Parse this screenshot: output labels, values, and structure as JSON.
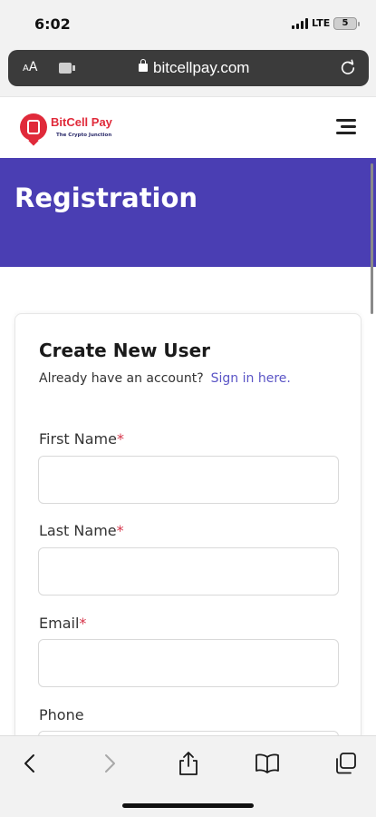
{
  "status_bar": {
    "time": "6:02",
    "network": "LTE",
    "battery": "5"
  },
  "browser": {
    "aa_label_small": "A",
    "aa_label_large": "A",
    "url": "bitcellpay.com"
  },
  "site": {
    "logo_name": "BitCell Pay",
    "logo_tagline": "The Crypto Junction"
  },
  "hero": {
    "title": "Registration",
    "background_color": "#4a3eb3"
  },
  "form": {
    "title": "Create New User",
    "subtitle": "Already have an account?",
    "signin_link": "Sign in here.",
    "required_marker": "*",
    "fields": [
      {
        "label": "First Name",
        "required": true,
        "value": ""
      },
      {
        "label": "Last Name",
        "required": true,
        "value": ""
      },
      {
        "label": "Email",
        "required": true,
        "value": ""
      },
      {
        "label": "Phone",
        "required": false,
        "value": ""
      }
    ]
  },
  "colors": {
    "brand_red": "#e02a3a",
    "link": "#5b55c6",
    "required": "#d6354a"
  },
  "icons": {
    "toolbar": [
      "back-icon",
      "forward-icon",
      "share-icon",
      "bookmarks-icon",
      "tabs-icon"
    ]
  }
}
